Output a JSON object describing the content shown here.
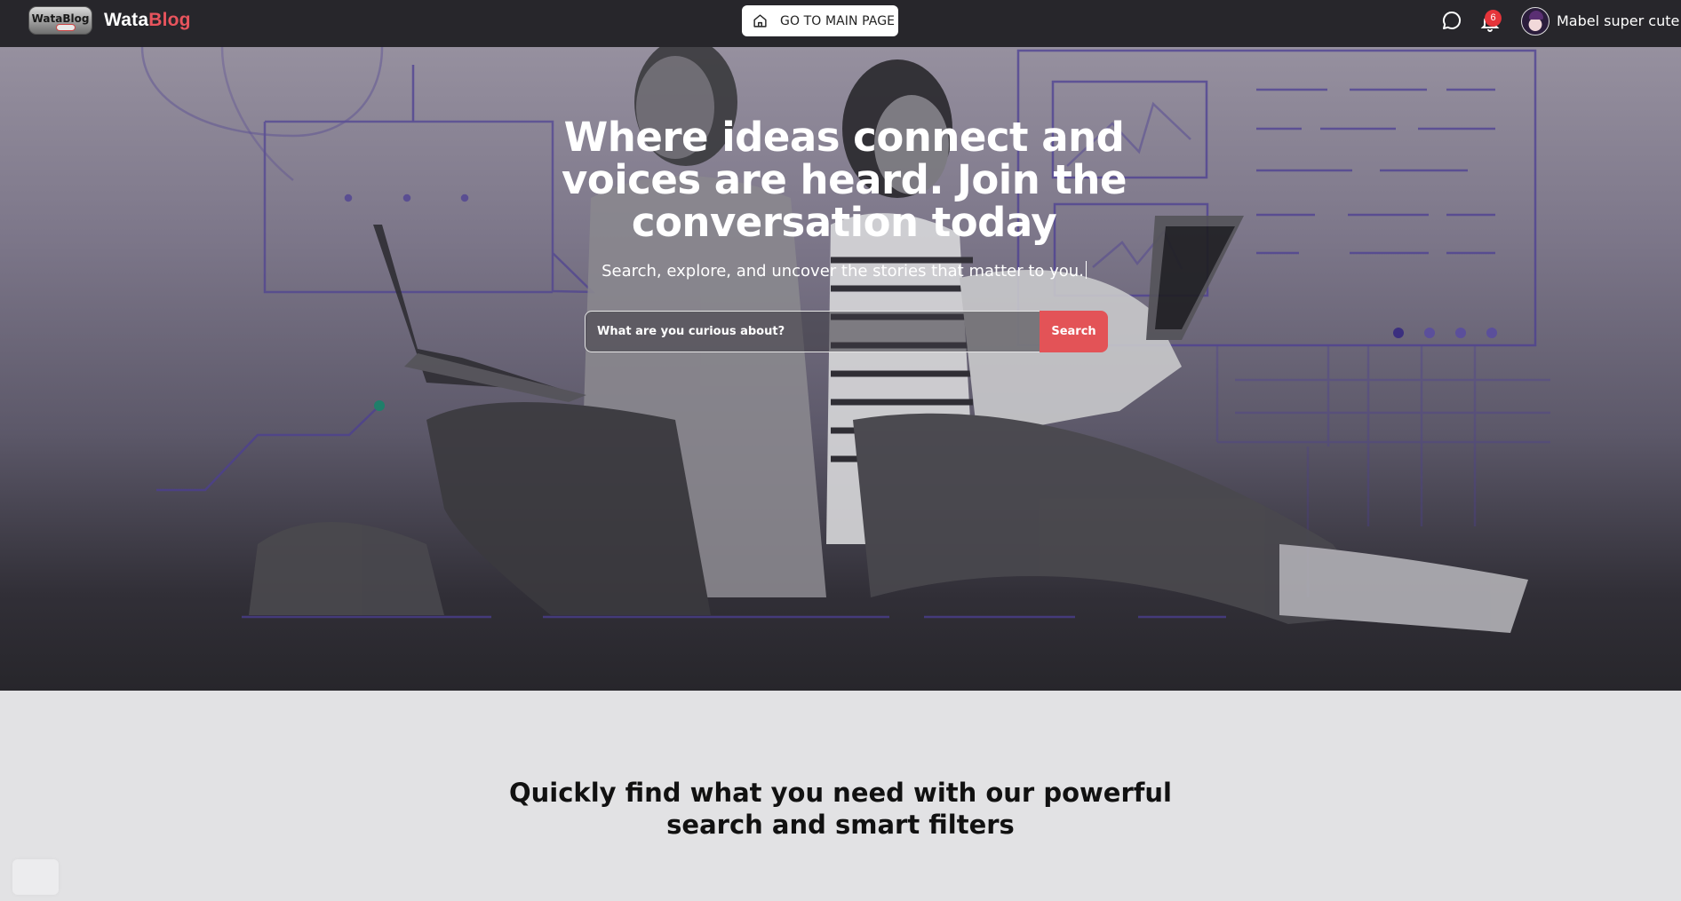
{
  "brand": {
    "logo_text": "WataBlog",
    "name_part1": "Wata",
    "name_part2": "Blog"
  },
  "nav": {
    "main_page_button": "GO TO MAIN PAGE",
    "notification_count": "6",
    "user_name": "Mabel super cute"
  },
  "hero": {
    "title": "Where ideas connect and voices are heard. Join the conversation today",
    "subtitle": "Search, explore, and uncover the stories that matter to you.",
    "search_placeholder": "What are you curious about?",
    "search_button": "Search"
  },
  "section": {
    "title": "Quickly find what you need with our powerful search and smart filters"
  },
  "colors": {
    "topbar": "#27262b",
    "accent": "#e35357",
    "brand_red": "#e8545d",
    "section_bg": "#e2e2e4"
  },
  "icons": [
    "home-icon",
    "chat-bubble-icon",
    "bell-icon"
  ]
}
